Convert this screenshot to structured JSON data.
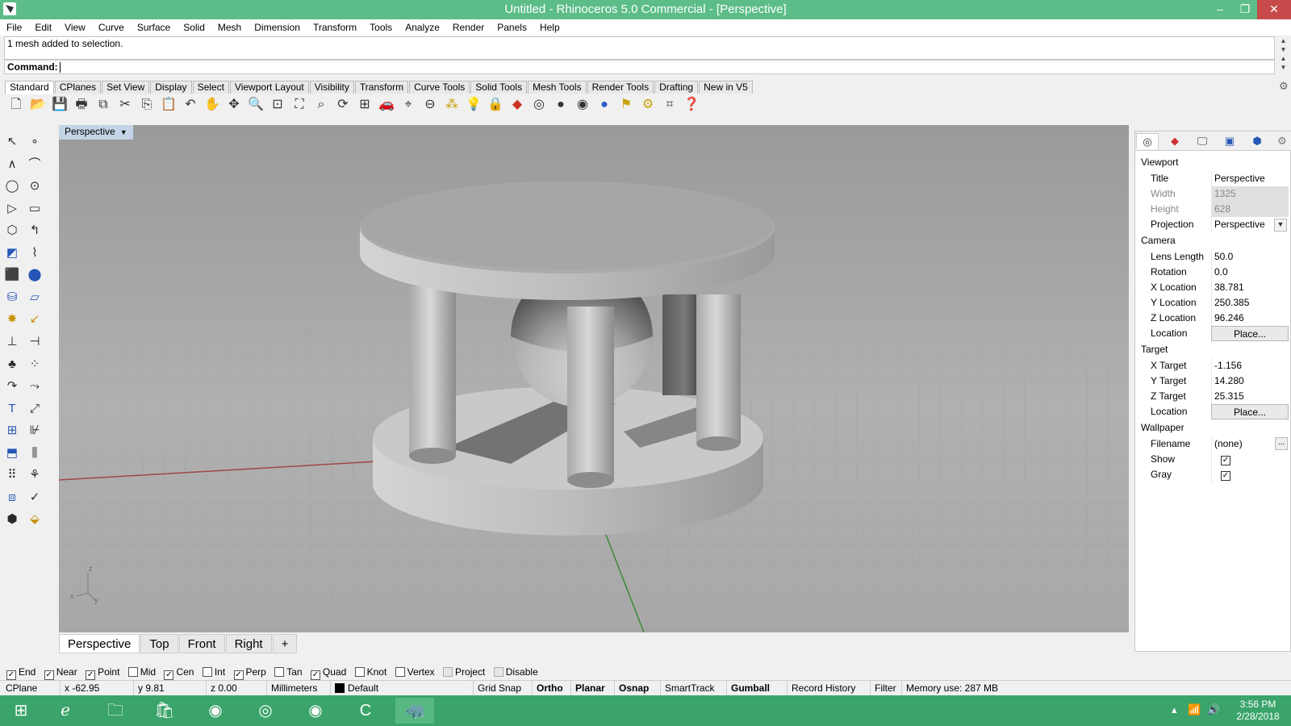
{
  "window": {
    "title": "Untitled - Rhinoceros 5.0 Commercial - [Perspective]",
    "min_glyph": "–",
    "max_glyph": "❐",
    "close_glyph": "✕"
  },
  "menu": [
    "File",
    "Edit",
    "View",
    "Curve",
    "Surface",
    "Solid",
    "Mesh",
    "Dimension",
    "Transform",
    "Tools",
    "Analyze",
    "Render",
    "Panels",
    "Help"
  ],
  "command": {
    "history": "1 mesh added to selection.",
    "label": "Command:"
  },
  "toolbar_tabs": [
    "Standard",
    "CPlanes",
    "Set View",
    "Display",
    "Select",
    "Viewport Layout",
    "Visibility",
    "Transform",
    "Curve Tools",
    "Solid Tools",
    "Mesh Tools",
    "Render Tools",
    "Drafting",
    "New in V5"
  ],
  "viewport": {
    "label": "Perspective"
  },
  "viewport_tabs": [
    "Perspective",
    "Top",
    "Front",
    "Right",
    "+"
  ],
  "panel": {
    "viewport_header": "Viewport",
    "title_label": "Title",
    "title_value": "Perspective",
    "width_label": "Width",
    "width_value": "1325",
    "height_label": "Height",
    "height_value": "628",
    "projection_label": "Projection",
    "projection_value": "Perspective",
    "camera_header": "Camera",
    "lens_label": "Lens Length",
    "lens_value": "50.0",
    "rotation_label": "Rotation",
    "rotation_value": "0.0",
    "xloc_label": "X Location",
    "xloc_value": "38.781",
    "yloc_label": "Y Location",
    "yloc_value": "250.385",
    "zloc_label": "Z Location",
    "zloc_value": "96.246",
    "loc_label": "Location",
    "place_label": "Place...",
    "target_header": "Target",
    "xtgt_label": "X Target",
    "xtgt_value": "-1.156",
    "ytgt_label": "Y Target",
    "ytgt_value": "14.280",
    "ztgt_label": "Z Target",
    "ztgt_value": "25.315",
    "tloc_label": "Location",
    "tplace_label": "Place...",
    "wallpaper_header": "Wallpaper",
    "filename_label": "Filename",
    "filename_value": "(none)",
    "filename_btn": "...",
    "show_label": "Show",
    "show_checked": true,
    "gray_label": "Gray",
    "gray_checked": true
  },
  "osnap": [
    {
      "label": "End",
      "checked": true
    },
    {
      "label": "Near",
      "checked": true
    },
    {
      "label": "Point",
      "checked": true
    },
    {
      "label": "Mid",
      "checked": false
    },
    {
      "label": "Cen",
      "checked": true
    },
    {
      "label": "Int",
      "checked": false
    },
    {
      "label": "Perp",
      "checked": true
    },
    {
      "label": "Tan",
      "checked": false
    },
    {
      "label": "Quad",
      "checked": true
    },
    {
      "label": "Knot",
      "checked": false
    },
    {
      "label": "Vertex",
      "checked": false
    },
    {
      "label": "Project",
      "checked": false
    },
    {
      "label": "Disable",
      "checked": false
    }
  ],
  "status": {
    "cplane": "CPlane",
    "x": "x -62.95",
    "y": "y 9.81",
    "z": "z 0.00",
    "units": "Millimeters",
    "layer": "Default",
    "grid_snap": "Grid Snap",
    "ortho": "Ortho",
    "planar": "Planar",
    "osnap": "Osnap",
    "smarttrack": "SmartTrack",
    "gumball": "Gumball",
    "record_history": "Record History",
    "filter": "Filter",
    "memory": "Memory use: 287 MB"
  },
  "clock": {
    "time": "3:56 PM",
    "date": "2/28/2018"
  }
}
